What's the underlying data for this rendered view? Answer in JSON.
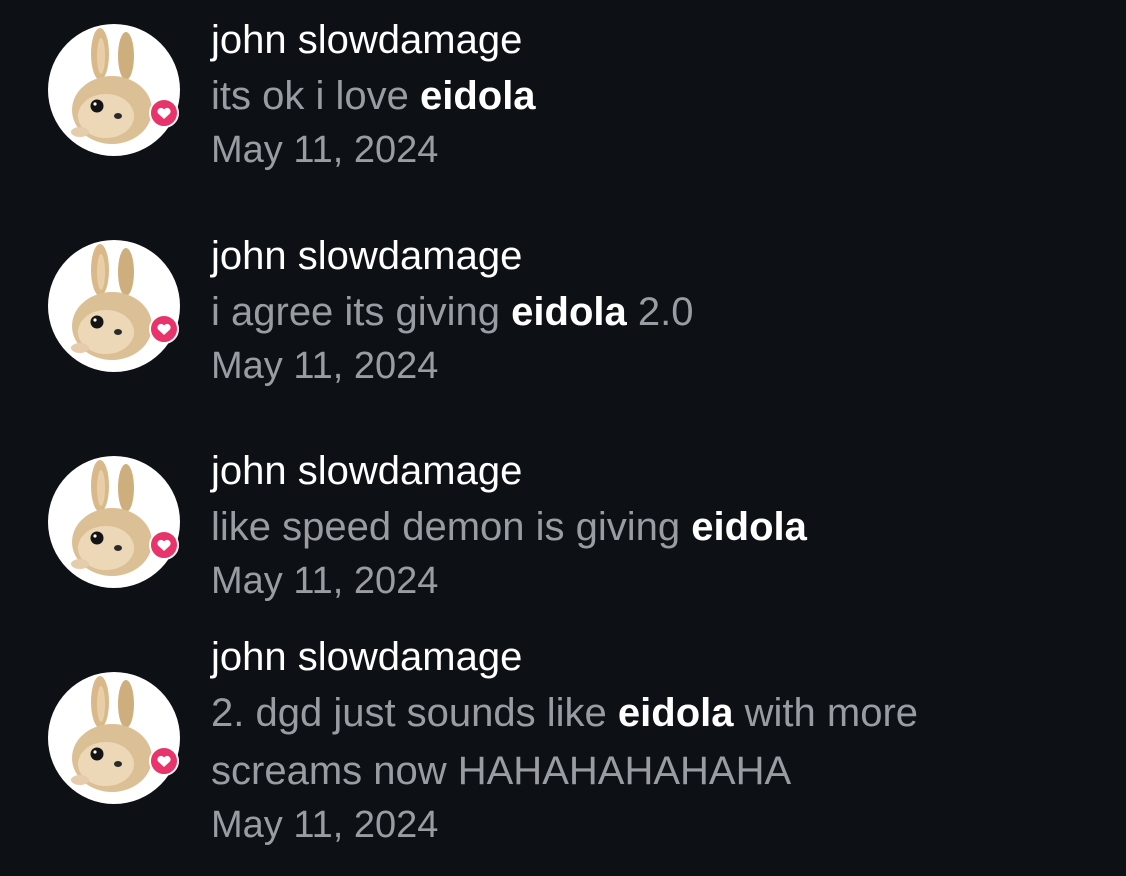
{
  "notifications": [
    {
      "author": "john slowdamage",
      "text_before": "its ok i love ",
      "highlight": "eidola",
      "text_after": "",
      "text_line2": "",
      "date": "May 11, 2024",
      "avatar_icon": "bunny-avatar",
      "badge_icon": "heart-bubble-icon"
    },
    {
      "author": "john slowdamage",
      "text_before": "i agree its giving ",
      "highlight": "eidola",
      "text_after": " 2.0",
      "text_line2": "",
      "date": "May 11, 2024",
      "avatar_icon": "bunny-avatar",
      "badge_icon": "heart-bubble-icon"
    },
    {
      "author": "john slowdamage",
      "text_before": "like speed demon is giving ",
      "highlight": "eidola",
      "text_after": "",
      "text_line2": "",
      "date": "May 11, 2024",
      "avatar_icon": "bunny-avatar",
      "badge_icon": "heart-bubble-icon"
    },
    {
      "author": "john slowdamage",
      "text_before": "2. dgd just sounds like ",
      "highlight": "eidola",
      "text_after": " with more",
      "text_line2": "screams now HAHAHAHAHAHA",
      "date": "May 11, 2024",
      "avatar_icon": "bunny-avatar",
      "badge_icon": "heart-bubble-icon"
    }
  ],
  "colors": {
    "background": "#0d1015",
    "author": "#ffffff",
    "body": "#9a9ca3",
    "highlight": "#ffffff",
    "badge": "#e8336b"
  }
}
